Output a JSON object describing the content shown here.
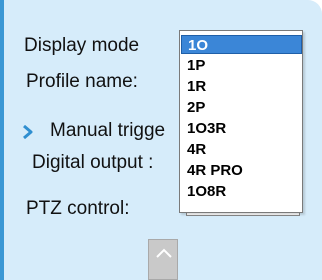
{
  "labels": {
    "display_mode": "Display mode",
    "profile_name": "Profile name:",
    "manual_trigger": "Manual trigge",
    "digital_output": "Digital output :",
    "ptz_control": "PTZ control:"
  },
  "display_mode_dropdown": {
    "selected": "1O",
    "options": [
      "1O",
      "1P",
      "1R",
      "2P",
      "1O3R",
      "4R",
      "4R PRO",
      "1O8R"
    ]
  },
  "colors": {
    "panel_background": "#d6ecfa",
    "accent_border": "#3a97d4",
    "selected_highlight": "#3b86d7"
  },
  "icons": {
    "manual_trigger_bullet": "chevron-right-icon",
    "scroll_up_button": "chevron-up-icon"
  }
}
